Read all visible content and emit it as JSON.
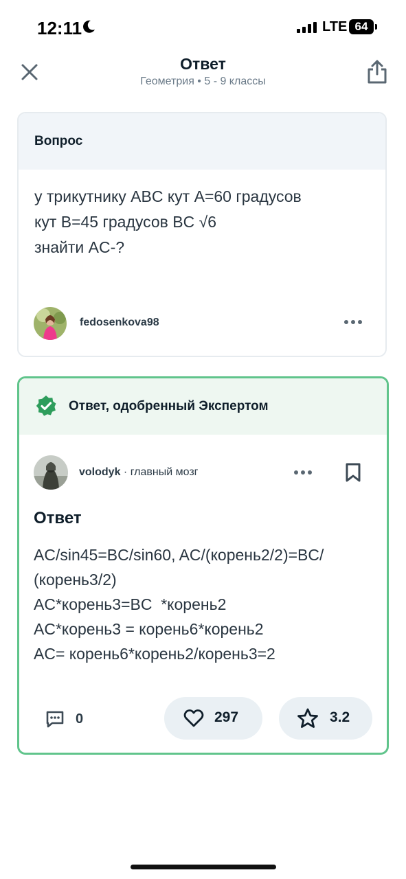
{
  "status_bar": {
    "time": "12:11",
    "network": "LTE",
    "battery": "64"
  },
  "header": {
    "title": "Ответ",
    "subtitle": "Геометрия • 5 - 9 классы"
  },
  "question": {
    "label": "Вопрос",
    "lines": [
      "у трикутнику ABC кут A=60 градусов",
      "кут B=45 градусов BC √6",
      "знайти AC-?"
    ],
    "author": "fedosenkova98"
  },
  "answer": {
    "badge_label": "Ответ, одобренный Экспертом",
    "author": "volodyk",
    "rank": " · главный мозг",
    "heading": "Ответ",
    "lines": [
      "AC/sin45=BC/sin60, AC/(корень2/2)=BC/",
      "(корень3/2)",
      "AC*корень3=BC  *корень2",
      "AC*корень3 = корень6*корень2",
      "AC= корень6*корень2/корень3=2"
    ],
    "comments_count": "0",
    "likes": "297",
    "rating": "3.2"
  },
  "colors": {
    "accent_green": "#60c48b",
    "badge_green": "#2e9d5c",
    "question_bg": "#f1f5f9",
    "answer_bg": "#eef7f1"
  }
}
